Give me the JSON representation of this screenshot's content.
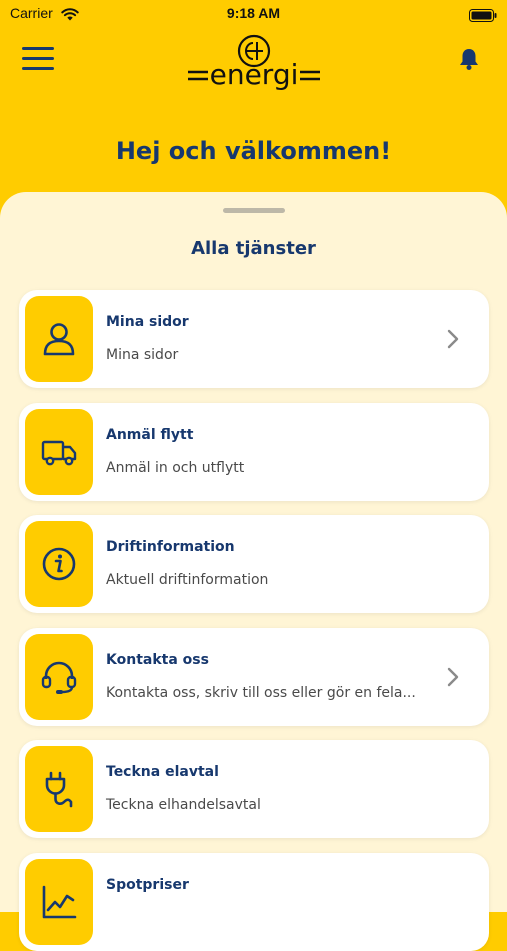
{
  "status_bar": {
    "carrier": "Carrier",
    "time": "9:18 AM"
  },
  "header": {
    "logo_text": "=energi=",
    "greeting": "Hej och välkommen!"
  },
  "section_title": "Alla tjänster",
  "services": [
    {
      "title": "Mina sidor",
      "subtitle": "Mina sidor",
      "icon": "user-icon",
      "chevron": true
    },
    {
      "title": "Anmäl flytt",
      "subtitle": "Anmäl in och utflytt",
      "icon": "truck-icon",
      "chevron": false
    },
    {
      "title": "Driftinformation",
      "subtitle": "Aktuell driftinformation",
      "icon": "info-icon",
      "chevron": false
    },
    {
      "title": "Kontakta oss",
      "subtitle": "Kontakta oss, skriv till oss eller gör en fela...",
      "icon": "headset-icon",
      "chevron": true
    },
    {
      "title": "Teckna elavtal",
      "subtitle": "Teckna elhandelsavtal",
      "icon": "plug-icon",
      "chevron": false
    },
    {
      "title": "Spotpriser",
      "subtitle": "",
      "icon": "chart-line-icon",
      "chevron": false
    }
  ],
  "colors": {
    "brand_yellow": "#FFCC00",
    "navy": "#17386E",
    "sheet": "#FFF5D5",
    "card": "#FFFFFF"
  }
}
